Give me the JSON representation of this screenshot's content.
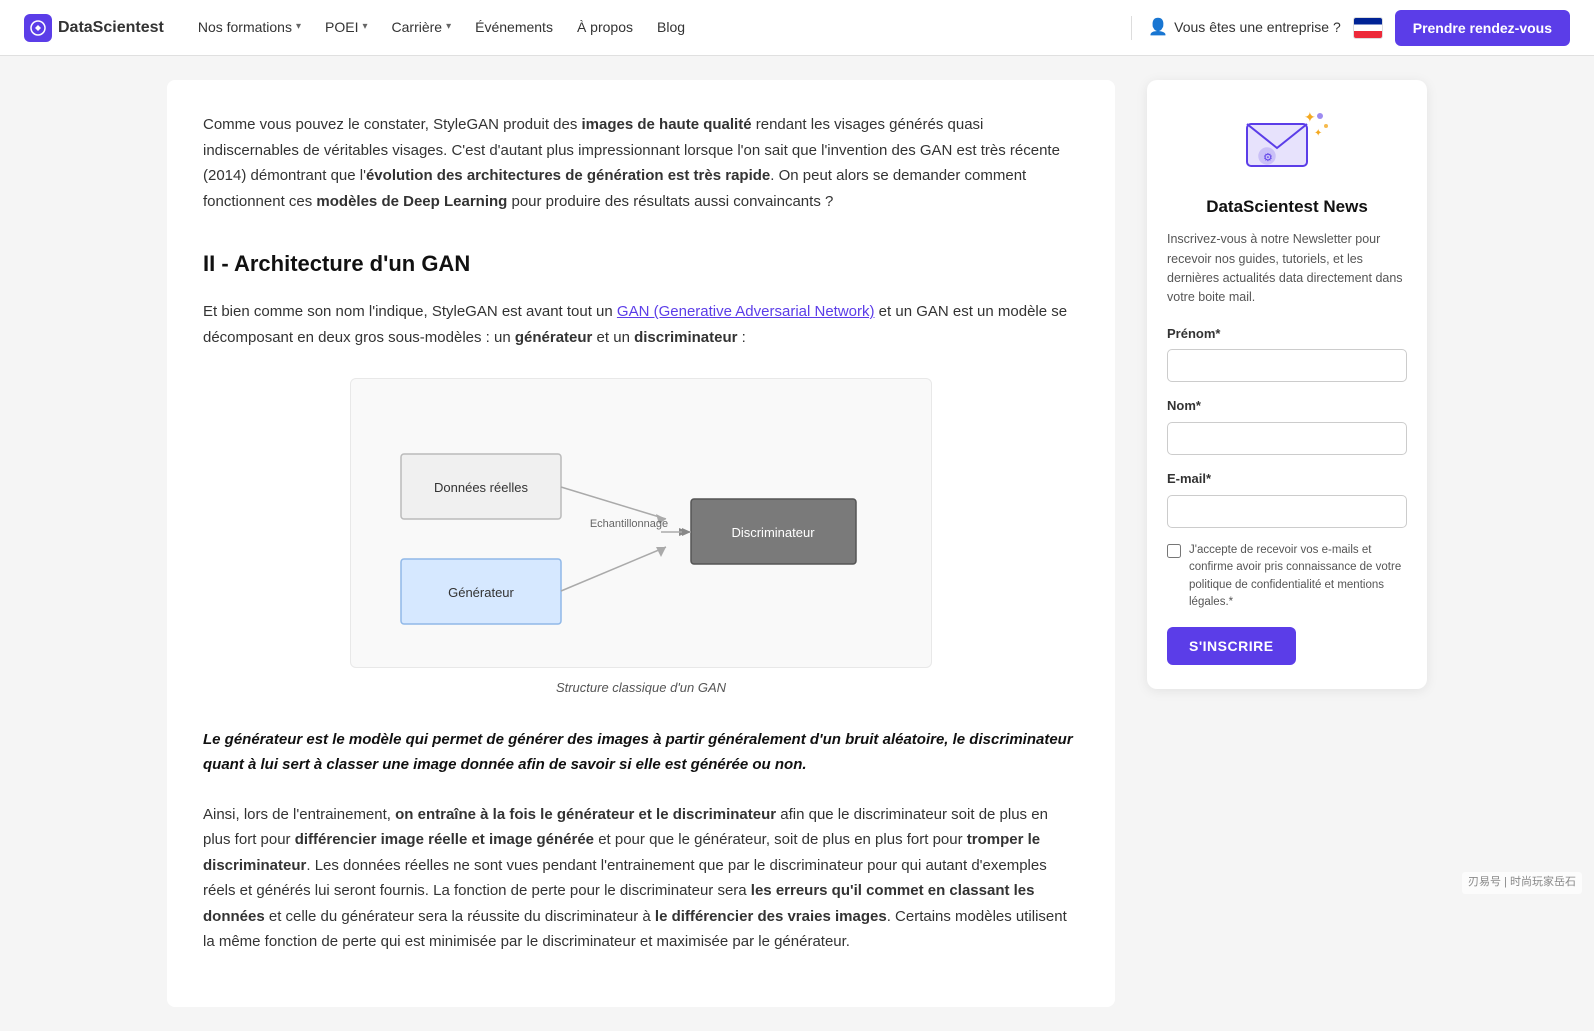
{
  "nav": {
    "logo_text": "DataScientest",
    "formations_label": "Nos formations",
    "poei_label": "POEI",
    "carriere_label": "Carrière",
    "evenements_label": "Événements",
    "apropos_label": "À propos",
    "blog_label": "Blog",
    "enterprise_label": "Vous êtes une entreprise ?",
    "cta_label": "Prendre rendez-vous"
  },
  "article": {
    "intro": "Comme vous pouvez le constater, StyleGAN produit des images de haute qualité rendant les visages générés quasi indiscernables de véritables visages. C'est d'autant plus impressionnant lorsque l'on sait que l'invention des GAN est très récente (2014) démontrant que l'évolution des architectures de génération est très rapide. On peut alors se demander comment fonctionnent ces modèles de Deep Learning pour produire des résultats aussi convaincants ?",
    "intro_bold1": "images de haute qualité",
    "intro_bold2": "évolution des architectures de génération est très rapide",
    "intro_bold3": "modèles de Deep Learning",
    "section2_title": "II - Architecture d'un GAN",
    "section2_intro": "Et bien comme son nom l'indique, StyleGAN est avant tout un GAN (Generative Adversarial Network) et un GAN est un modèle se décomposant en deux gros sous-modèles : un générateur et un discriminateur :",
    "section2_link": "GAN (Generative Adversarial Network)",
    "section2_bold1": "générateur",
    "section2_bold2": "discriminateur",
    "diagram_label1": "Données réelles",
    "diagram_label2": "Echantillonnage",
    "diagram_label3": "Discriminateur",
    "diagram_label4": "Générateur",
    "diagram_caption": "Structure classique d'un GAN",
    "blockquote": "Le générateur est le modèle qui permet de générer des images à partir généralement d'un bruit aléatoire, le discriminateur quant à lui sert à classer une image donnée afin de savoir si elle est générée ou non.",
    "paragraph3": "Ainsi, lors de l'entrainement, on entraîne à la fois le générateur et le discriminateur afin que le discriminateur soit de plus en plus fort pour différencier image réelle et image générée et pour que le générateur, soit de plus en plus fort pour tromper le discriminateur. Les données réelles ne sont vues pendant l'entrainement que par le discriminateur pour qui autant d'exemples réels et générés lui seront fournis. La fonction de perte pour le discriminateur sera les erreurs qu'il commet en classant les données et celle du générateur sera la réussite du discriminateur à le différencier des vraies images. Certains modèles utilisent la même fonction de perte qui est minimisée par le discriminateur et maximisée par le générateur.",
    "para3_bold1": "on entraîne à la fois le générateur et le discriminateur",
    "para3_bold2": "différencier image réelle et image générée",
    "para3_bold3": "tromper le discriminateur",
    "para3_bold4": "les erreurs qu'il commet en classant les données",
    "para3_bold5": "le différencier des vraies images"
  },
  "newsletter": {
    "title": "DataScientest News",
    "description": "Inscrivez-vous à notre Newsletter pour recevoir nos guides, tutoriels, et les dernières actualités data directement dans votre boite mail.",
    "prenom_label": "Prénom*",
    "nom_label": "Nom*",
    "email_label": "E-mail*",
    "prenom_placeholder": "",
    "nom_placeholder": "",
    "email_placeholder": "",
    "checkbox_label": "J'accepte de recevoir vos e-mails et confirme avoir pris connaissance de votre politique de confidentialité et mentions légales.*",
    "submit_label": "S'INSCRIRE"
  },
  "watermark": "刃易号 | 时尚玩家岳石"
}
